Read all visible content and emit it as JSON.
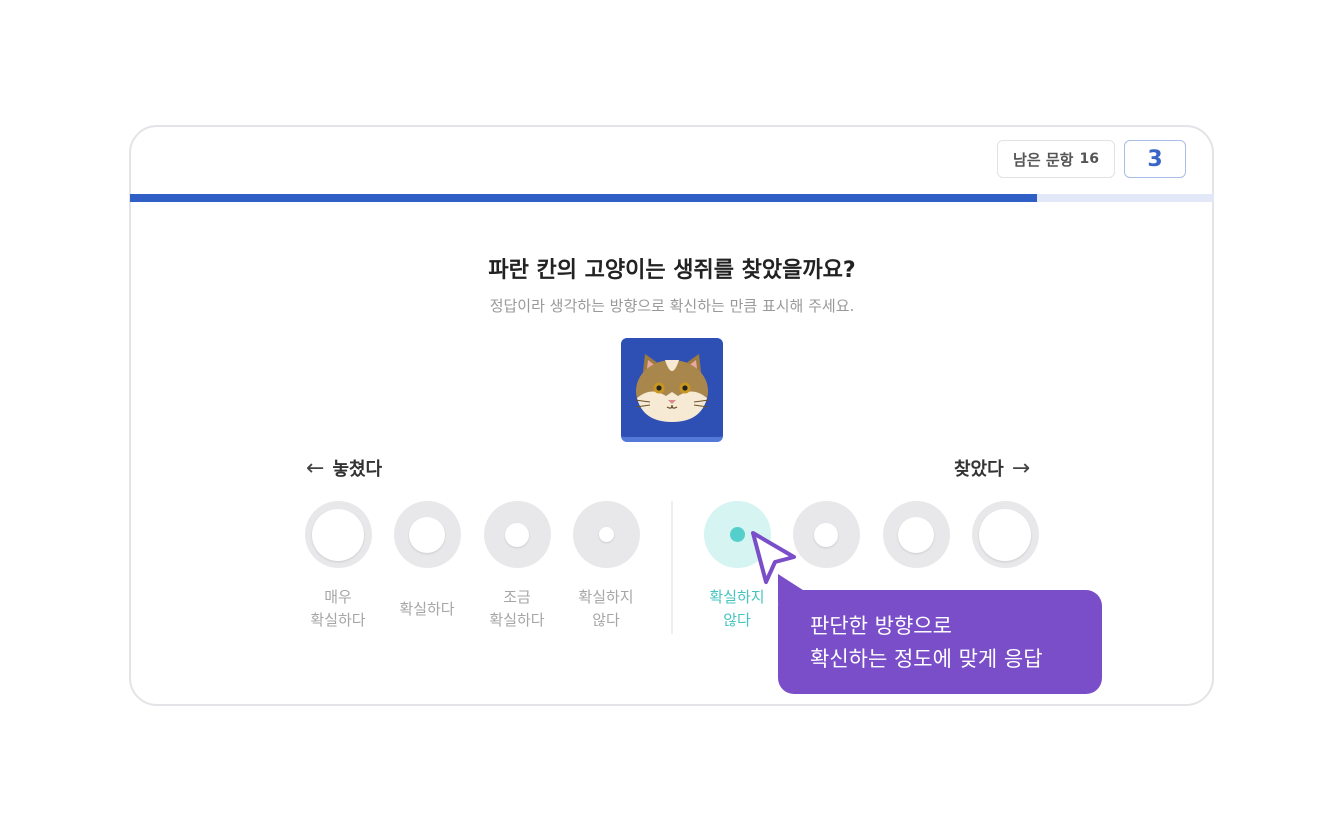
{
  "header": {
    "remaining_label": "남은 문항",
    "remaining_count": "16",
    "question_number": "3"
  },
  "progress": {
    "fraction": 0.837
  },
  "question": {
    "title": "파란 칸의 고양이는 생쥐를 찾았을까요?",
    "instruction": "정답이라 생각하는 방향으로 확신하는 만큼 표시해 주세요."
  },
  "stimulus": {
    "icon": "cat-face-icon"
  },
  "scale": {
    "left_label": "놓쳤다",
    "right_label": "찾았다",
    "left_arrow": "←",
    "right_arrow": "→",
    "options": [
      {
        "label": "매우\n확실하다"
      },
      {
        "label": "확실하다"
      },
      {
        "label": "조금\n확실하다"
      },
      {
        "label": "확실하지\n않다"
      },
      {
        "label": "확실하지\n않다",
        "selected": true
      },
      {
        "label": ""
      },
      {
        "label": ""
      },
      {
        "label": ""
      }
    ]
  },
  "tooltip": {
    "line1": "판단한 방향으로",
    "line2": "확신하는 정도에 맞게 응답"
  },
  "colors": {
    "accent": "#2f5fc4",
    "selected": "#55cfcb",
    "tooltip": "#7a4ec8"
  }
}
